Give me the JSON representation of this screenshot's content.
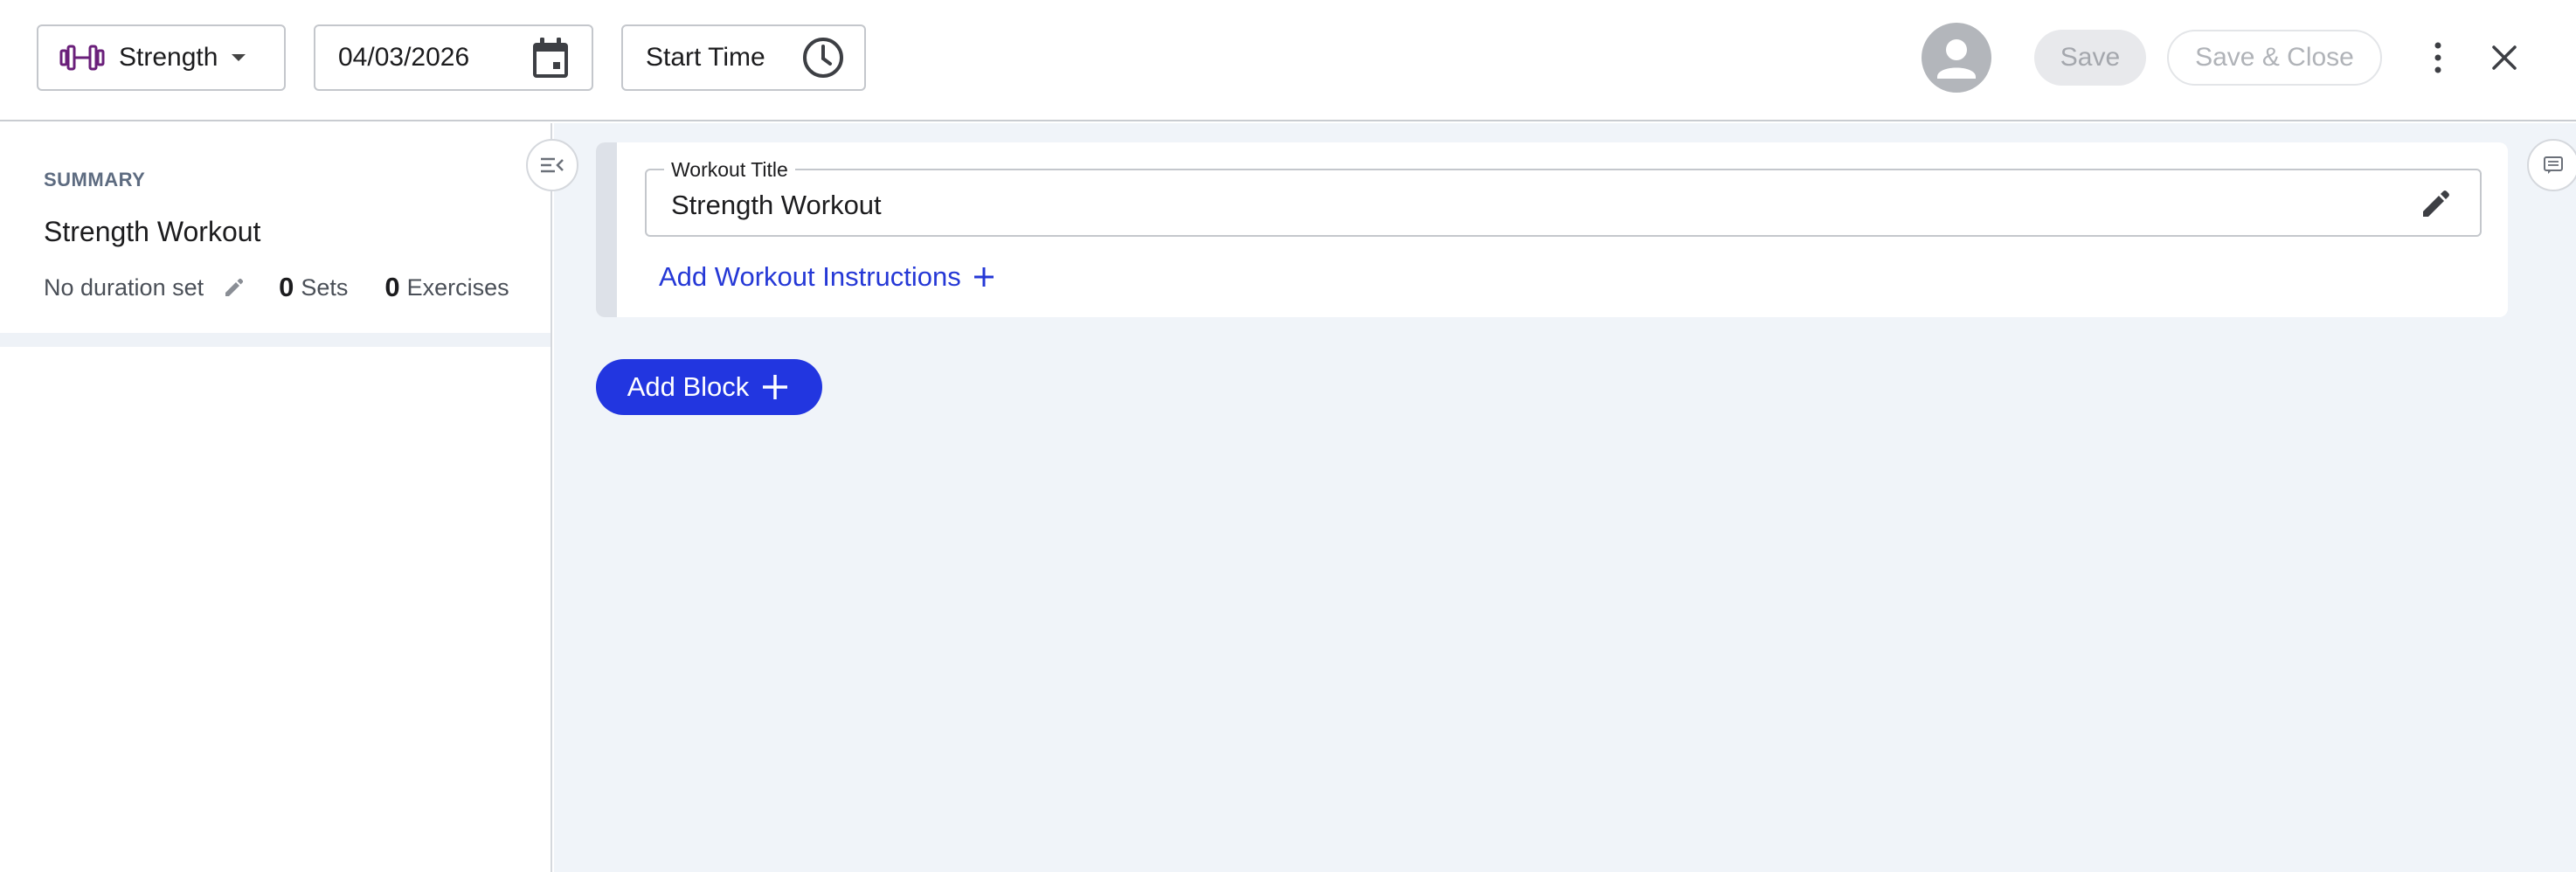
{
  "header": {
    "workout_type": "Strength",
    "workout_type_icon": "dumbbell-icon",
    "date_value": "04/03/2026",
    "start_time_label": "Start Time",
    "save_label": "Save",
    "save_close_label": "Save & Close"
  },
  "sidebar": {
    "heading": "SUMMARY",
    "title": "Strength Workout",
    "duration_text": "No duration set",
    "sets_count": "0",
    "sets_label": "Sets",
    "exercises_count": "0",
    "exercises_label": "Exercises"
  },
  "main": {
    "title_field_label": "Workout Title",
    "title_field_value": "Strength Workout",
    "add_instructions_label": "Add Workout Instructions",
    "add_block_label": "Add Block"
  },
  "colors": {
    "accent": "#2236e0",
    "link": "#2538d6",
    "dumbbell": "#6a1f7a",
    "main_bg": "#f0f4f9"
  }
}
